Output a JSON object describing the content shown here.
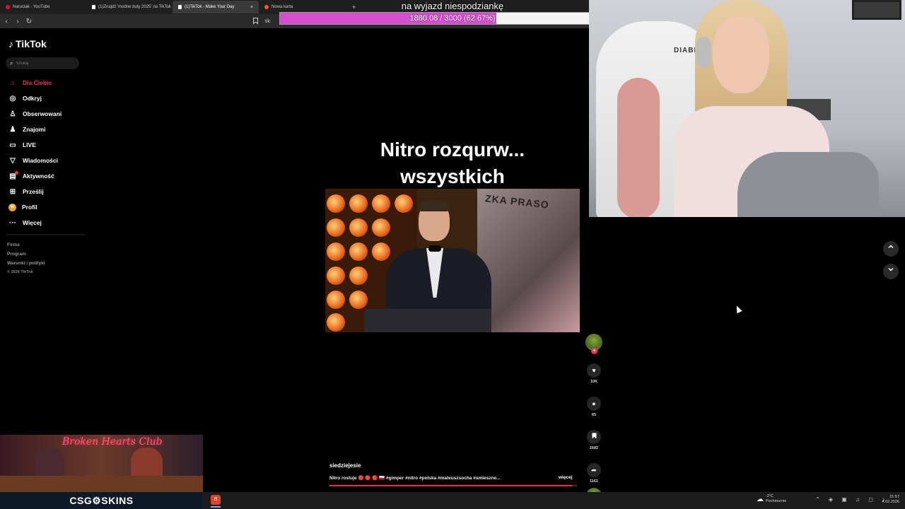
{
  "browser": {
    "tabs": [
      {
        "title": "Naruciak - YouTube",
        "favicon_color": "#ff0033",
        "active": false
      },
      {
        "title": "(1)Znajdź 'modne buty 2025' na TikTok",
        "favicon_color": "#ffffff",
        "active": false
      },
      {
        "title": "(1)TikTok - Make Your Day",
        "favicon_color": "#ffffff",
        "active": true
      },
      {
        "title": "Nowa karta",
        "favicon_color": "#fb542b",
        "active": false
      }
    ],
    "tab_close": "×",
    "new_tab": "+",
    "nav_back": "‹",
    "nav_forward": "›",
    "nav_reload": "↻",
    "bookmark_icon": "bookmark-icon",
    "address_prefix": "tik"
  },
  "donation_goal": {
    "title": "na wyjazd niespodziankę",
    "text": "1880.08 / 3000 (62.67%)",
    "current": 1880.08,
    "target": 3000,
    "percent": 62.67,
    "fill_color": "#d44fd0"
  },
  "tiktok": {
    "logo": "TikTok",
    "search_placeholder": "Szukaj",
    "nav": [
      {
        "label": "Dla Ciebie",
        "icon": "home-icon",
        "glyph": "⌂",
        "active": true
      },
      {
        "label": "Odkryj",
        "icon": "compass-icon",
        "glyph": "◎",
        "active": false
      },
      {
        "label": "Obserwowani",
        "icon": "following-icon",
        "glyph": "♙",
        "active": false
      },
      {
        "label": "Znajomi",
        "icon": "friends-icon",
        "glyph": "♟",
        "active": false
      },
      {
        "label": "LIVE",
        "icon": "live-icon",
        "glyph": "▭",
        "active": false
      },
      {
        "label": "Wiadomości",
        "icon": "messages-icon",
        "glyph": "▽",
        "active": false
      },
      {
        "label": "Aktywność",
        "icon": "activity-icon",
        "glyph": "▤",
        "active": false
      },
      {
        "label": "Prześlij",
        "icon": "upload-icon",
        "glyph": "⊞",
        "active": false
      },
      {
        "label": "Profil",
        "icon": "profile-icon",
        "glyph": "W",
        "active": false
      },
      {
        "label": "Więcej",
        "icon": "more-icon",
        "glyph": "···",
        "active": false
      }
    ],
    "footer": {
      "links": [
        "Firma",
        "Program",
        "Warunki i polityki"
      ],
      "copyright": "© 2026 TikTok"
    },
    "accent_color": "#fe2c55",
    "video": {
      "title_line1": "Nitro rozqurw...",
      "title_line2": "wszystkich",
      "banner_text": "ZKA PRASO",
      "author": "siedziejesie",
      "caption": "Nitro rostuje 🔴 🔴 🔴 🇵🇱 #gimper #nitro #polska #mateuszsocha #smieszne...",
      "more_label": "więcej",
      "progress": 0.98
    },
    "actions": {
      "follow_plus": "+",
      "likes": "10K",
      "comments": "65",
      "saves": "1682",
      "shares": "1161"
    },
    "scroll_up": "⌃",
    "scroll_down": "⌄"
  },
  "overlay": {
    "promo_title": "Broken Hearts Club",
    "sponsor": "CSG⚙SKINS"
  },
  "webcam": {
    "chair_brand": "DIABLO"
  },
  "taskbar": {
    "app_glyph": "B",
    "weather_temp": "-2°C",
    "weather_desc": "Pochmurnie",
    "tray_icons": "⌃ ◈ ▣ ♫ ◻ ♪",
    "time": "21:57",
    "date": "4.02.2026"
  }
}
